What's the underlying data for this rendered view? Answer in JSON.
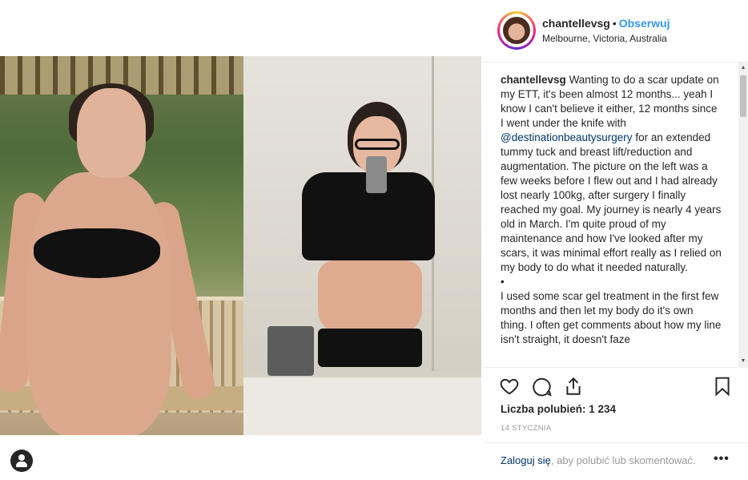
{
  "post": {
    "username": "chantellevsg",
    "separator": "•",
    "follow_label": "Obserwuj",
    "location": "Melbourne, Victoria, Australia"
  },
  "caption": {
    "author": "chantellevsg",
    "text_part1": "Wanting to do a scar update on my ETT, it's been almost 12 months... yeah I know I can't believe it either, 12 months since I went under the knife with",
    "mention": "@destinationbeautysurgery",
    "text_part2": "for an extended tummy tuck and breast lift/reduction and augmentation. The picture on the left was a few weeks before I flew out and I had already lost nearly 100kg, after surgery I finally reached my goal. My journey is nearly 4 years old in March. I'm quite proud of my maintenance and how I've looked after my scars, it was minimal effort really as I relied on my body to do what it needed naturally.",
    "bullet": "•",
    "text_part3": "I used some scar gel treatment in the first few months and then let my body do it's own thing. I often get comments about how my line isn't straight, it doesn't faze"
  },
  "actions": {
    "like_icon": "heart-icon",
    "comment_icon": "comment-icon",
    "share_icon": "share-icon",
    "save_icon": "bookmark-icon",
    "likes_label": "Liczba polubień:",
    "likes_count": "1 234",
    "date": "14 STYCZNIA"
  },
  "login": {
    "link": "Zaloguj się",
    "rest": ", aby polubić lub skomentować.",
    "more": "•••"
  },
  "colors": {
    "follow": "#3897f0",
    "link": "#003569",
    "muted": "#999999"
  }
}
